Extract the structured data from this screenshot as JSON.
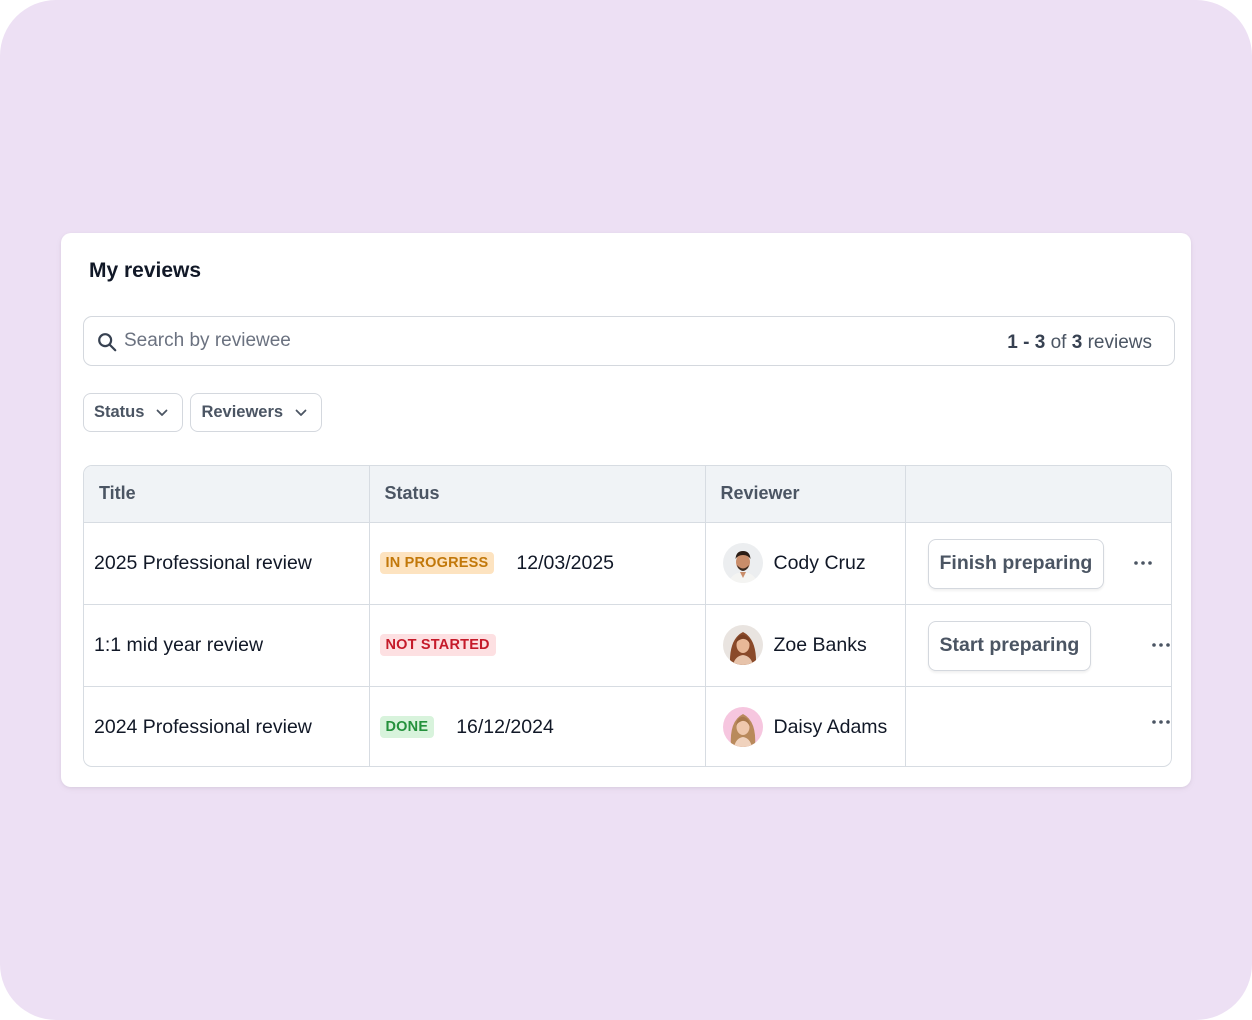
{
  "card": {
    "title": "My reviews"
  },
  "search": {
    "placeholder": "Search by reviewee",
    "count": {
      "from": "1",
      "sep": " - ",
      "to": "3",
      "of": " of ",
      "total": "3",
      "suffix": " reviews"
    }
  },
  "filters": [
    {
      "label": "Status"
    },
    {
      "label": "Reviewers"
    }
  ],
  "table": {
    "headers": {
      "title": "Title",
      "status": "Status",
      "reviewer": "Reviewer",
      "actions": ""
    },
    "rows": [
      {
        "title": "2025 Professional review",
        "status": "IN PROGRESS",
        "status_kind": "progress",
        "date": "12/03/2025",
        "reviewer": "Cody Cruz",
        "action": "Finish preparing"
      },
      {
        "title": "1:1 mid year review",
        "status": "NOT STARTED",
        "status_kind": "notstarted",
        "date": "",
        "reviewer": "Zoe Banks",
        "action": "Start preparing"
      },
      {
        "title": "2024 Professional review",
        "status": "DONE",
        "status_kind": "done",
        "date": "16/12/2024",
        "reviewer": "Daisy Adams",
        "action": ""
      }
    ]
  },
  "colors": {
    "backdrop": "#ede0f4",
    "in_progress_bg": "#fde3c0",
    "in_progress_text": "#c2780a",
    "not_started_bg": "#fde0e2",
    "not_started_text": "#c51a2a",
    "done_bg": "#d8f3dc",
    "done_text": "#24913c"
  },
  "icons": {
    "search": "search-icon",
    "filter_chevron": "chevron-down-icon",
    "more": "more-horizontal-icon"
  }
}
